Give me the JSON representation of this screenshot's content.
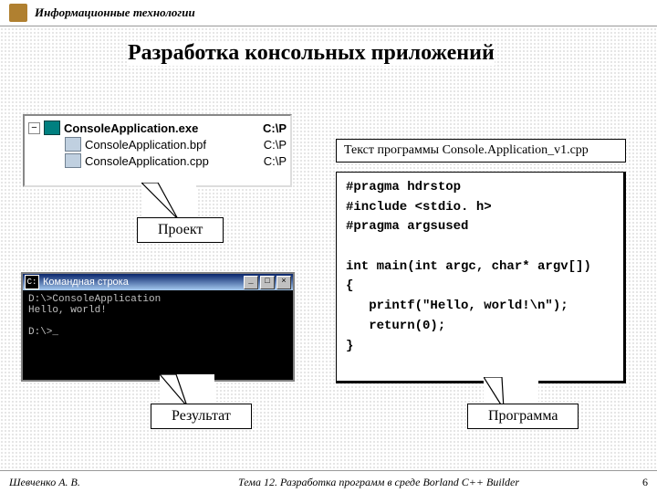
{
  "header": {
    "title": "Информационные технологии"
  },
  "main_title": "Разработка консольных приложений",
  "tree": {
    "rows": [
      {
        "name": "ConsoleApplication.exe",
        "path": "C:\\P",
        "bold": true,
        "root": true
      },
      {
        "name": "ConsoleApplication.bpf",
        "path": "C:\\P"
      },
      {
        "name": "ConsoleApplication.cpp",
        "path": "C:\\P"
      }
    ]
  },
  "labels": {
    "project": "Проект",
    "result": "Результат",
    "program": "Программа"
  },
  "console": {
    "title": "Командная строка",
    "body": "D:\\>ConsoleApplication\nHello, world!\n\nD:\\>_"
  },
  "code": {
    "title": "Текст программы Console.Application_v1.cpp",
    "body": "#pragma hdrstop\n#include <stdio. h>\n#pragma argsused\n\nint main(int argc, char* argv[])\n{\n   printf(\"Hello, world!\\n\");\n   return(0);\n}"
  },
  "footer": {
    "author": "Шевченко А. В.",
    "topic": "Тема 12. Разработка программ в среде Borland C++ Builder",
    "page": "6"
  }
}
